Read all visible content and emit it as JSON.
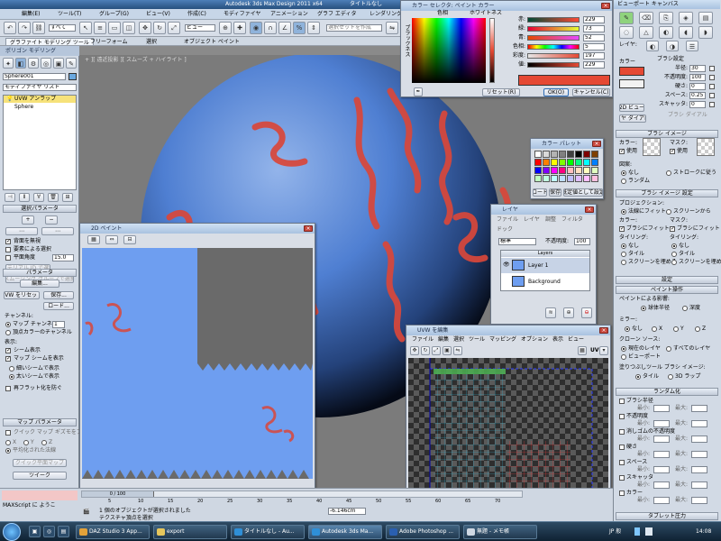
{
  "app": {
    "title": "Autodesk 3ds Max Design 2011 x64",
    "doc_title": "タイトルなし"
  },
  "menu": [
    "編集(E)",
    "ツール(T)",
    "グループ(G)",
    "ビュー(V)",
    "作成(C)",
    "モディファイヤ",
    "アニメーション",
    "グラフ エディタ",
    "レンダリング(R)",
    "照明分析"
  ],
  "toolbar": {
    "select_filter": "すべて",
    "view_dropdown": "ビュー",
    "selection_set": "選択セットを作成"
  },
  "ribbon_tabs": [
    "グラファイト モデリング ツール",
    "フリーフォーム",
    "選択",
    "オブジェクト ペイント"
  ],
  "ribbon_sub": "ポリゴン モデリング",
  "viewport_label": "+ ][ 遠近投影 ][ スムーズ + ハイライト ]",
  "left": {
    "object_name": "Sphere001",
    "modifier_list": "モディファイヤ リスト",
    "stack": [
      "UVW アンラップ",
      "Sphere"
    ],
    "selection_params": "選択パラメータ",
    "ignore_back": "背面を無視",
    "select_by_element": "要素による選択",
    "planar_angle": "平面角度",
    "planar_value": "15.0",
    "select_by_mat": "マテリアル ID で選択",
    "select_by_smooth": "スムージング グループで選択",
    "params": "パラメータ",
    "edit_btn": "編集...",
    "uvw_reset": "UVW をリセット",
    "save_btn": "保存...",
    "load_btn": "ロード...",
    "channel_label": "チャンネル:",
    "map_channel": "マップ チャンネル:",
    "map_channel_value": "1",
    "vertex_color": "頂点カラーのチャンネル",
    "display": "表示:",
    "show_seams": "シーム表示",
    "show_map_seams": "マップ シームを表示",
    "thin_seams": "細いシームで表示",
    "thick_seams": "太いシームで表示",
    "prevent_reflatten": "再フラット化を防ぐ",
    "map_params": "マップ パラメータ",
    "quick_planar": "クイック マップ ギズモをプレビュー",
    "axes": [
      "X",
      "Y",
      "Z"
    ],
    "align_avg": "平均化された法線",
    "quick_planar_btn": "クイック平面マップ",
    "twist": "ツイーク"
  },
  "paint2d": {
    "title": "2D ペイント",
    "zoom": "0 / 100"
  },
  "color_picker": {
    "title": "カラー セレクタ: ペイント カラー",
    "hue_label": "色相",
    "whiteness": "ホワイトネス",
    "blackness": "ブラックネス",
    "rows": [
      {
        "label": "赤:",
        "value": "229"
      },
      {
        "label": "緑:",
        "value": "73"
      },
      {
        "label": "青:",
        "value": "52"
      },
      {
        "label": "色相:",
        "value": "5"
      },
      {
        "label": "彩度:",
        "value": "197"
      },
      {
        "label": "値:",
        "value": "229"
      }
    ],
    "reset": "リセット(R)",
    "ok": "OK(O)",
    "cancel": "キャンセル(C)",
    "current_color": "#e54934"
  },
  "color_palette": {
    "title": "カラー パレット",
    "load": "ロード",
    "save": "保存",
    "default": "既定値として設定",
    "colors": [
      "#ffffff",
      "#d9d9d9",
      "#b3b3b3",
      "#808080",
      "#404040",
      "#000000",
      "#7f0000",
      "#7f3f00",
      "#ff0000",
      "#ff7f00",
      "#ffff00",
      "#7fff00",
      "#00ff00",
      "#00ff7f",
      "#00ffff",
      "#007fff",
      "#0000ff",
      "#7f00ff",
      "#ff00ff",
      "#ff007f",
      "#ffbfbf",
      "#ffdfbf",
      "#ffffbf",
      "#dfffbf",
      "#bfffbf",
      "#bfffdf",
      "#bfffff",
      "#bfdfff",
      "#bfbfff",
      "#dfbfff",
      "#ffbfff",
      "#ffbfdf",
      "#7f7f00",
      "#007f00",
      "#007f7f",
      "#00007f"
    ]
  },
  "layers": {
    "title": "レイヤ",
    "menu": [
      "ファイル",
      "レイヤ",
      "調整",
      "フィルタ"
    ],
    "menu2": "ドック",
    "blend": "標準",
    "opacity_label": "不透明度:",
    "opacity": "100",
    "header": "Layers",
    "items": [
      "Layer 1",
      "Background"
    ]
  },
  "uvw": {
    "title": "UVW を編集",
    "menu": [
      "ファイル",
      "編集",
      "選択",
      "ツール",
      "マッピング",
      "オプション",
      "表示",
      "ビュー"
    ],
    "uv_label": "UV"
  },
  "right": {
    "title": "ビューポート キャンバス",
    "layer_label": "レイヤ:",
    "color_label": "カラー",
    "brush_label": "ブラシ設定",
    "radius": "半径:",
    "radius_val": "30",
    "opacity": "不透明度:",
    "opacity_val": "100",
    "hardness": "硬さ:",
    "hardness_val": "0",
    "spacing": "スペース:",
    "spacing_val": "0.25",
    "scatter": "スキャッタ:",
    "scatter_val": "0",
    "brush_dial": "ブラシ ダイアル",
    "view2d": "2D ビュー",
    "layer_dialog": "レイヤ ダイアログ",
    "brush_image": "ブラシ イメージ",
    "color_lbl": "カラー:",
    "mask_lbl": "マスク:",
    "use": "使用",
    "pattern": "図案:",
    "none": "なし",
    "stroke": "ストロークに従う",
    "random": "ランダム",
    "brush_image_settings": "ブラシ イメージ 設定",
    "projection": "プロジェクション:",
    "normal_match": "法線にフィット",
    "screen_match": "スクリーンから",
    "color2": "カラー:",
    "mask2": "マスク:",
    "brush_fit": "ブラシにフィット",
    "tiling": "タイリング:",
    "tiling2": "タイリング:",
    "none2": "なし",
    "tile": "タイル",
    "screen_fit": "スクリーンを埋める",
    "settings": "設定",
    "paint_ops": "ペイント操作",
    "paint_by_normal": "ペイントによる影響:",
    "sphere_radius": "球体半径",
    "depth": "深度",
    "mirror": "ミラー:",
    "clone_source": "クローン ソース:",
    "current_layer": "現在のレイヤ",
    "all_layers": "すべてのレイヤ",
    "viewport": "ビューポート",
    "fill_mode": "塗りつぶしツール ブラシ イメージ:",
    "fill_tile": "タイル",
    "fill_3d": "3D ラップ",
    "randomize": "ランダム化",
    "rand_radius": "ブラシ半径",
    "rand_opacity": "不透明度",
    "rand_erase": "消しゴムの不透明度",
    "rand_hardness": "硬さ",
    "rand_space": "スペース",
    "rand_scatter": "スキャッタ",
    "rand_color": "カラー",
    "min": "最小:",
    "max": "最大:",
    "tablet": "タブレット圧力"
  },
  "status": {
    "selected": "1 個のオブジェクトが選択されました",
    "hint": "テクスチャ頂点を選択",
    "maxscript": "MAXScript に ようこ",
    "coord": "-6.146cm",
    "frame": "0 / 100",
    "ticks": [
      "5",
      "10",
      "15",
      "20",
      "25",
      "30",
      "35",
      "40",
      "45",
      "50",
      "55",
      "60",
      "65",
      "70"
    ]
  },
  "taskbar": {
    "items": [
      "DAZ Studio 3 App...",
      "export",
      "タイトルなし - Au...",
      "Autodesk 3ds Ma...",
      "Adobe Photoshop ...",
      "無題 - メモ帳"
    ],
    "clock": "14:08",
    "lang": "JP 般"
  }
}
